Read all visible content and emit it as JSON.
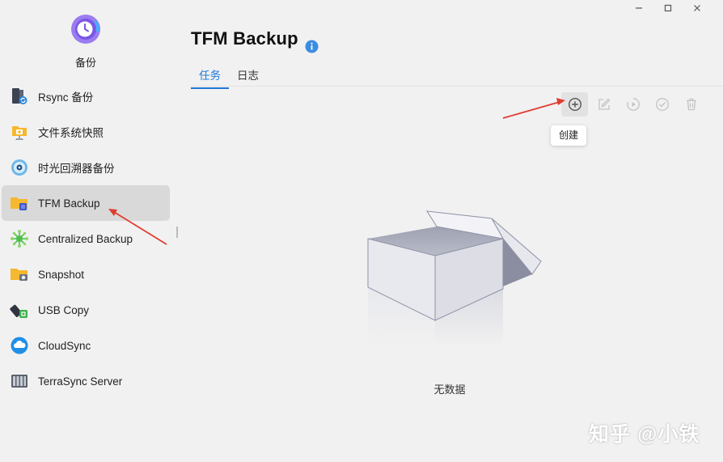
{
  "app": {
    "name": "备份",
    "page_title": "TFM Backup"
  },
  "sidebar": {
    "items": [
      {
        "label": "Rsync 备份",
        "icon": "rsync-server-icon"
      },
      {
        "label": "文件系统快照",
        "icon": "filesystem-snapshot-icon"
      },
      {
        "label": "时光回溯器备份",
        "icon": "time-machine-icon"
      },
      {
        "label": "TFM Backup",
        "icon": "tfm-backup-folder-icon",
        "active": true
      },
      {
        "label": "Centralized Backup",
        "icon": "centralized-backup-icon"
      },
      {
        "label": "Snapshot",
        "icon": "snapshot-folder-icon"
      },
      {
        "label": "USB Copy",
        "icon": "usb-copy-icon"
      },
      {
        "label": "CloudSync",
        "icon": "cloudsync-icon"
      },
      {
        "label": "TerraSync Server",
        "icon": "terrasync-server-icon"
      }
    ]
  },
  "tabs": [
    {
      "label": "任务",
      "active": true
    },
    {
      "label": "日志",
      "active": false
    }
  ],
  "toolbar": {
    "buttons": [
      "create-icon",
      "edit-icon",
      "run-icon",
      "check-icon",
      "delete-icon"
    ],
    "tooltip": "创建"
  },
  "empty_state": {
    "text": "无数据"
  },
  "watermark": "知乎 @小铁",
  "colors": {
    "accent": "#1e78d7",
    "annotation_arrow": "#e03c31",
    "active_item_bg": "#d9d9d9"
  }
}
